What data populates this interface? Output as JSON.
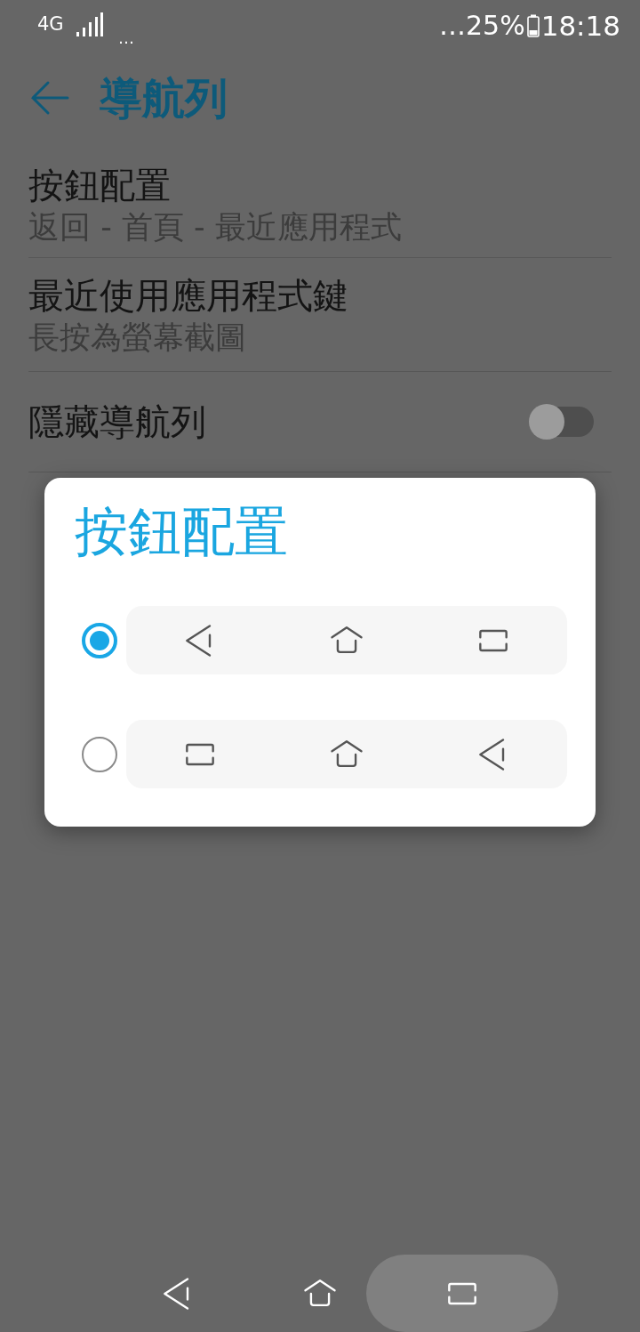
{
  "status_bar": {
    "network": "4G",
    "overflow": "…",
    "battery_text": "…25%",
    "time": "18:18"
  },
  "app_bar": {
    "title": "導航列"
  },
  "settings": [
    {
      "kind": "detail",
      "title": "按鈕配置",
      "summary": "返回 - 首頁 - 最近應用程式"
    },
    {
      "kind": "detail",
      "title": "最近使用應用程式鍵",
      "summary": "長按為螢幕截圖"
    },
    {
      "kind": "switch",
      "title": "隱藏導航列",
      "on": false
    }
  ],
  "dialog": {
    "title": "按鈕配置",
    "options": [
      {
        "selected": true,
        "buttons": [
          {
            "kind": "back"
          },
          {
            "kind": "home"
          },
          {
            "kind": "recents"
          }
        ]
      },
      {
        "selected": false,
        "buttons": [
          {
            "kind": "recents"
          },
          {
            "kind": "home"
          },
          {
            "kind": "back"
          }
        ]
      }
    ]
  },
  "nav_bar": {
    "buttons": [
      {
        "kind": "back",
        "highlighted": false
      },
      {
        "kind": "home",
        "highlighted": false
      },
      {
        "kind": "recents",
        "highlighted": true
      }
    ]
  }
}
